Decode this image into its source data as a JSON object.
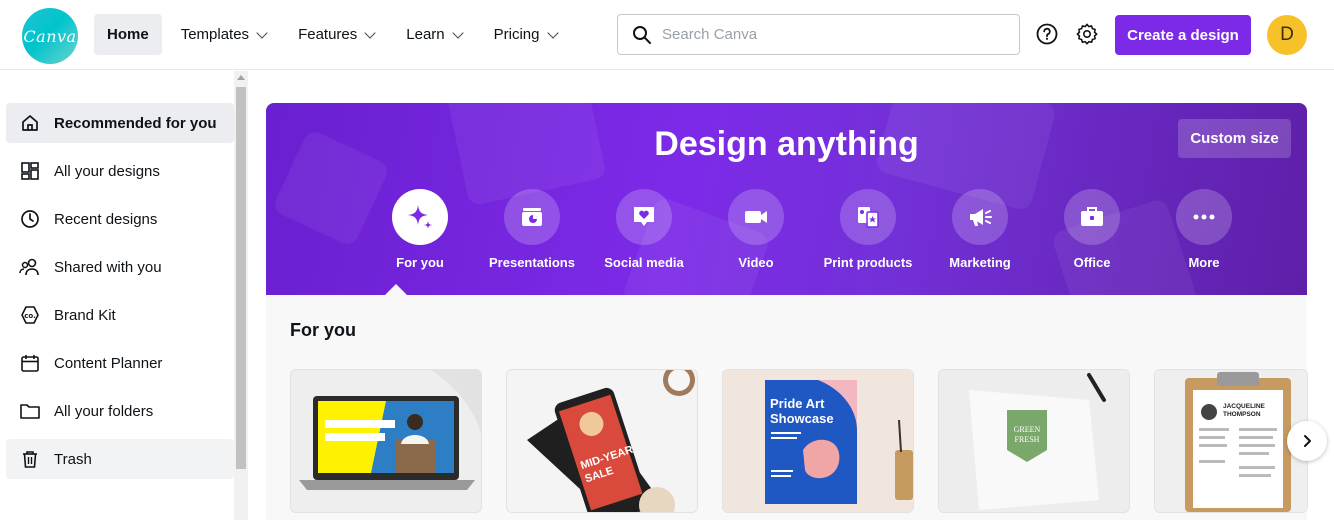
{
  "logo": {
    "text": "Canva"
  },
  "nav": {
    "items": [
      {
        "label": "Home"
      },
      {
        "label": "Templates"
      },
      {
        "label": "Features"
      },
      {
        "label": "Learn"
      },
      {
        "label": "Pricing"
      }
    ]
  },
  "search": {
    "placeholder": "Search Canva",
    "value": ""
  },
  "header": {
    "create_label": "Create a design",
    "avatar_initial": "D",
    "help_icon": "help-circle-icon",
    "settings_icon": "gear-icon"
  },
  "sidebar": {
    "items": [
      {
        "label": "Recommended for you",
        "icon": "home-icon"
      },
      {
        "label": "All your designs",
        "icon": "grid-icon"
      },
      {
        "label": "Recent designs",
        "icon": "clock-icon"
      },
      {
        "label": "Shared with you",
        "icon": "people-icon"
      },
      {
        "label": "Brand Kit",
        "icon": "brand-kit-icon"
      },
      {
        "label": "Content Planner",
        "icon": "calendar-icon"
      },
      {
        "label": "All your folders",
        "icon": "folder-icon"
      },
      {
        "label": "Trash",
        "icon": "trash-icon"
      }
    ]
  },
  "hero": {
    "title": "Design anything",
    "custom_size_label": "Custom size",
    "categories": [
      {
        "label": "For you",
        "icon": "sparkle-icon"
      },
      {
        "label": "Presentations",
        "icon": "presentation-icon"
      },
      {
        "label": "Social media",
        "icon": "heart-chat-icon"
      },
      {
        "label": "Video",
        "icon": "video-camera-icon"
      },
      {
        "label": "Print products",
        "icon": "print-icon"
      },
      {
        "label": "Marketing",
        "icon": "megaphone-icon"
      },
      {
        "label": "Office",
        "icon": "briefcase-icon"
      },
      {
        "label": "More",
        "icon": "more-dots-icon"
      }
    ]
  },
  "for_you": {
    "title": "For you",
    "cards": [
      {
        "name": "laptop-presentation-template"
      },
      {
        "name": "phone-sale-story-template",
        "text_1": "MID-YEAR",
        "text_2": "SALE"
      },
      {
        "name": "pride-art-poster-template",
        "text_1": "Pride Art",
        "text_2": "Showcase"
      },
      {
        "name": "logo-template",
        "text_1": "GREEN",
        "text_2": "FRESH"
      },
      {
        "name": "resume-template",
        "text_1": "JACQUELINE",
        "text_2": "THOMPSON"
      }
    ]
  },
  "colors": {
    "accent": "#7d2ae8",
    "logo": "#00c4cc",
    "avatar": "#f7c229"
  }
}
